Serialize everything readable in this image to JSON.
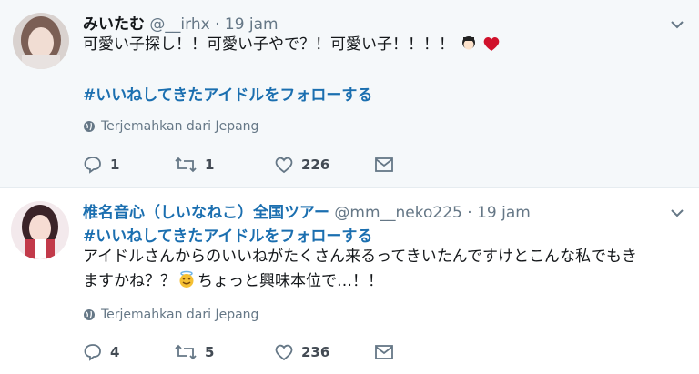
{
  "tweets": [
    {
      "name": "みいたむ",
      "handle": "@__irhx",
      "dot": "·",
      "time": "19 jam",
      "text": "可愛い子探し！！可愛い子やで？！可愛い子！！！！",
      "hashtag": "#いいねしてきたアイドルをフォローする",
      "translate": "Terjemahkan dari Jepang",
      "replies": "1",
      "retweets": "1",
      "likes": "226"
    },
    {
      "name": "椎名音心（しいなねこ）全国ツアー",
      "handle": "@mm__neko225",
      "dot": "·",
      "time": "19 jam",
      "hashtag": "#いいねしてきたアイドルをフォローする",
      "text_line1": "アイドルさんからのいいねがたくさん来るってきいたんですけとこんな私でもき",
      "text_line2a": "ますかね？？",
      "text_line2b": "ちょっと興味本位で…！！",
      "translate": "Terjemahkan dari Jepang",
      "replies": "4",
      "retweets": "5",
      "likes": "236"
    }
  ],
  "colors": {
    "link": "#1b6fb0",
    "muted": "#657786",
    "heart": "#d0112b"
  }
}
